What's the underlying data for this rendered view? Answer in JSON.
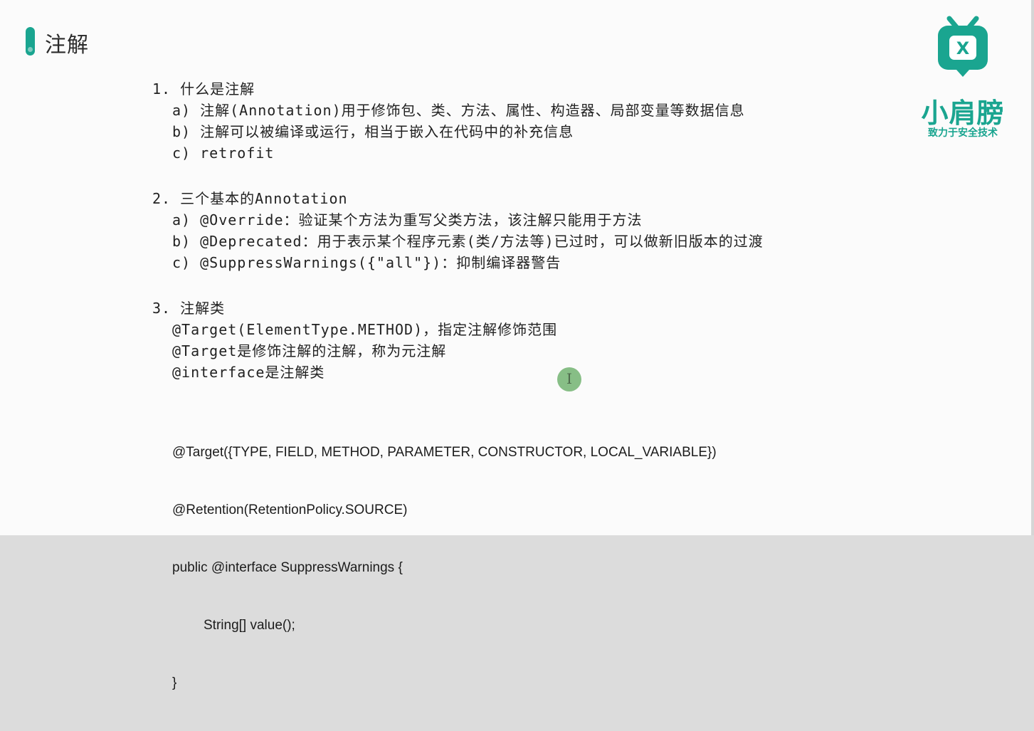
{
  "header": {
    "title": "注解"
  },
  "logo": {
    "name": "小肩膀",
    "slogan": "致力于安全技术",
    "brand_color": "#1aa590"
  },
  "sections": [
    {
      "title": "1.  什么是注解",
      "items": [
        "a) 注解(Annotation)用于修饰包、类、方法、属性、构造器、局部变量等数据信息",
        "b) 注解可以被编译或运行，相当于嵌入在代码中的补充信息",
        "c) retrofit"
      ]
    },
    {
      "title": "2.  三个基本的Annotation",
      "items": [
        "a) @Override：验证某个方法为重写父类方法，该注解只能用于方法",
        "b) @Deprecated：用于表示某个程序元素(类/方法等)已过时，可以做新旧版本的过渡",
        "c) @SuppressWarnings({\"all\"})：抑制编译器警告"
      ]
    },
    {
      "title": "3.  注解类",
      "items": [
        "@Target(ElementType.METHOD)，指定注解修饰范围",
        "@Target是修饰注解的注解，称为元注解",
        "@interface是注解类"
      ]
    }
  ],
  "code": {
    "lines": [
      "@Target({TYPE, FIELD, METHOD, PARAMETER, CONSTRUCTOR, LOCAL_VARIABLE})",
      "@Retention(RetentionPolicy.SOURCE)",
      "public @interface SuppressWarnings {",
      "String[] value();",
      "}"
    ]
  }
}
